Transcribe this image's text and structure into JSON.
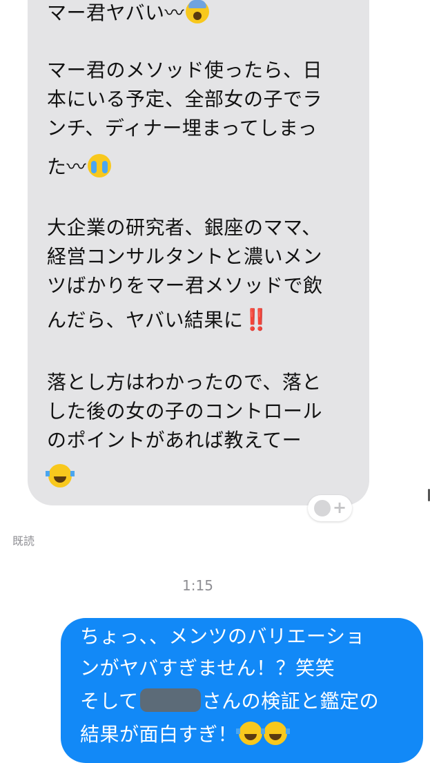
{
  "incoming": {
    "line1": "マー君ヤバい〰",
    "line2": "マー君のメソッド使ったら、日",
    "line3": "本にいる予定、全部女の子でラ",
    "line4": "ンチ、ディナー埋まってしまっ",
    "line5": "た〰",
    "line6": "大企業の研究者、銀座のママ、",
    "line7": "経営コンサルタントと濃いメン",
    "line8": "ツばかりをマー君メソッドで飲",
    "line9": "んだら、ヤバい結果に",
    "line9_emphasis": "‼️",
    "line10": "落とし方はわかったので、落と",
    "line11": "した後の女の子のコントロール",
    "line12": "のポイントがあれば教えてー"
  },
  "emojis": {
    "shock": "face-screaming-in-fear",
    "cry": "loudly-crying-face",
    "laugh": "face-with-tears-of-joy"
  },
  "status": {
    "read": "既読",
    "time": "1:15"
  },
  "outgoing": {
    "line1": "ちょっ、、メンツのバリエーショ",
    "line2": "ンがヤバすぎません！？笑笑",
    "line3_prefix": "そして",
    "line3_suffix": "さんの検証と鑑定の",
    "line4": "結果が面白すぎ！"
  },
  "colors": {
    "incoming_bubble": "#e4e4e6",
    "outgoing_bubble": "#1289f7",
    "meta_text": "#8e8e93"
  }
}
